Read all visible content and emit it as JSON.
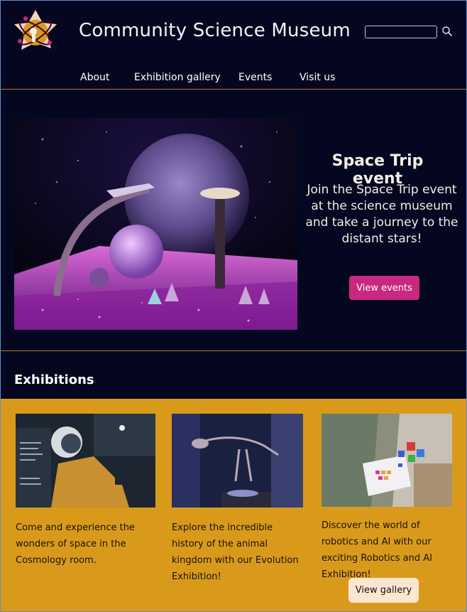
{
  "header": {
    "site_title": "Community Science Museum",
    "search": {
      "placeholder": "",
      "value": ""
    },
    "logo_icon": "atom-logo-icon",
    "search_icon": "search-icon",
    "nav": [
      {
        "label": "About"
      },
      {
        "label": "Exhibition gallery"
      },
      {
        "label": "Events"
      },
      {
        "label": "Visit us"
      }
    ]
  },
  "hero": {
    "title": "Space Trip event",
    "text": "Join the Space Trip event at the science museum and take a journey to the distant stars!",
    "button_label": "View events",
    "image": "space-diorama-image"
  },
  "exhibitions": {
    "heading": "Exhibitions",
    "cards": [
      {
        "text": "Come and experience the wonders of space in the Cosmology room.",
        "image": "astronaut-suit-image"
      },
      {
        "text": "Explore the incredible history of the animal kingdom with our Evolution Exhibition!",
        "image": "dinosaur-skeleton-image"
      },
      {
        "text": "Discover the world of robotics and AI with our exciting Robotics and AI Exhibition!",
        "image": "robotics-tablet-image"
      }
    ],
    "button_label": "View gallery"
  },
  "colors": {
    "background": "#05061f",
    "accent_pink": "#c8287f",
    "section_gold": "#d99a1c",
    "divider": "#b07a26",
    "button_light": "#fbe6d2"
  }
}
